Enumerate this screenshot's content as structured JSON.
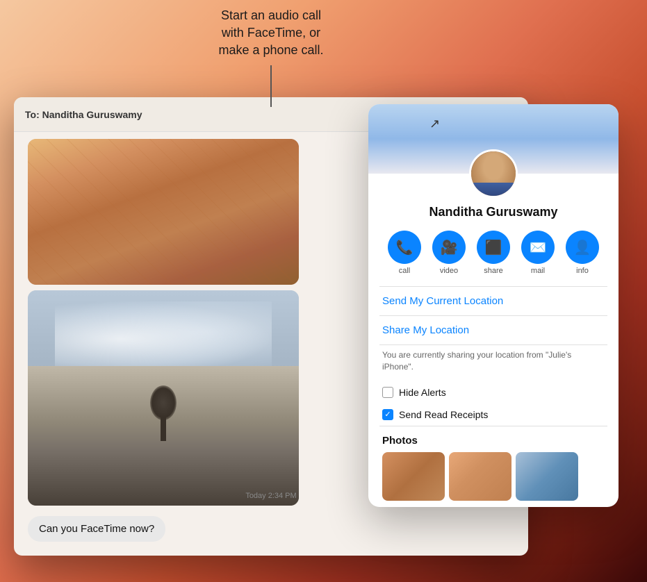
{
  "tooltip": {
    "text": "Start an audio call\nwith FaceTime, or\nmake a phone call."
  },
  "header": {
    "to_label": "To:",
    "contact_name": "Nanditha Guruswamy",
    "info_button_label": "ⓘ"
  },
  "contact_panel": {
    "name": "Nanditha Guruswamy",
    "action_buttons": [
      {
        "label": "call",
        "icon": "📞"
      },
      {
        "label": "video",
        "icon": "📹"
      },
      {
        "label": "share",
        "icon": "📤"
      },
      {
        "label": "mail",
        "icon": "✉️"
      },
      {
        "label": "info",
        "icon": "👤"
      }
    ],
    "menu_items": [
      "Send My Current Location",
      "Share My Location"
    ],
    "location_text": "You are currently sharing your location from \"Julie's iPhone\".",
    "checkboxes": [
      {
        "label": "Hide Alerts",
        "checked": false
      },
      {
        "label": "Send Read Receipts",
        "checked": true
      }
    ],
    "photos_label": "Photos"
  },
  "messages": {
    "timestamp": "Today 2:34 PM",
    "bubble_text": "Can you FaceTime now?"
  }
}
